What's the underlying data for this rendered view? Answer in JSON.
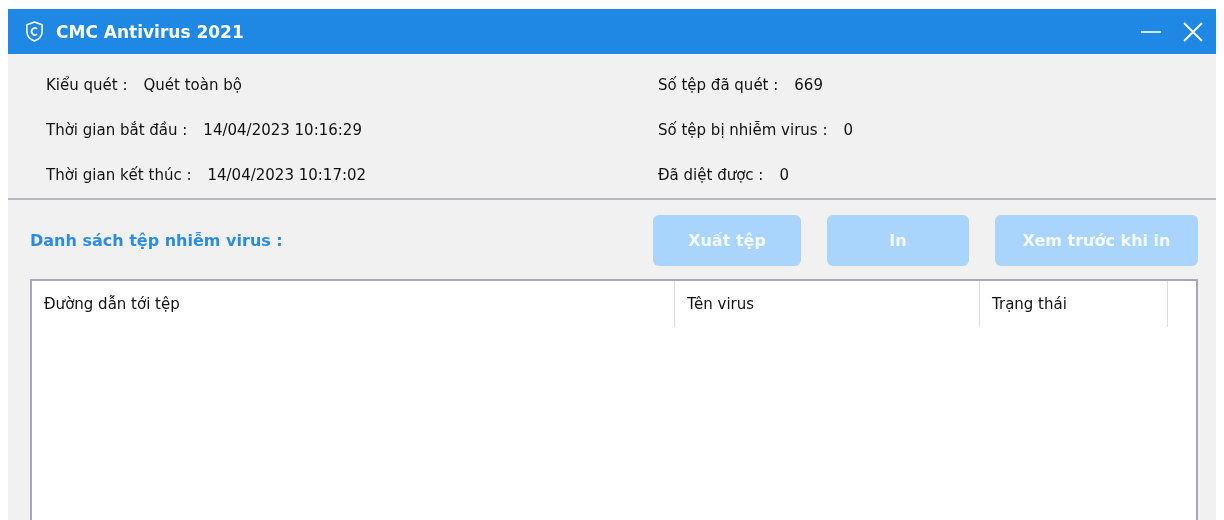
{
  "window": {
    "title": "CMC Antivirus 2021"
  },
  "scan_info": {
    "left": [
      {
        "label": "Kiểu quét :",
        "value": "Quét toàn bộ"
      },
      {
        "label": "Thời gian bắt đầu :",
        "value": "14/04/2023 10:16:29"
      },
      {
        "label": "Thời gian kết thúc :",
        "value": "14/04/2023 10:17:02"
      }
    ],
    "right": [
      {
        "label": "Số tệp đã quét :",
        "value": "669"
      },
      {
        "label": "Số tệp bị nhiễm virus :",
        "value": "0"
      },
      {
        "label": "Đã diệt được :",
        "value": "0"
      }
    ]
  },
  "list_title": "Danh sách tệp nhiễm virus :",
  "buttons": [
    {
      "label": "Xuất tệp",
      "disabled": true
    },
    {
      "label": "In",
      "disabled": true
    },
    {
      "label": "Xem trước khi in",
      "disabled": true
    }
  ],
  "table": {
    "columns": [
      "Đường dẫn tới tệp",
      "Tên virus",
      "Trạng thái"
    ]
  }
}
